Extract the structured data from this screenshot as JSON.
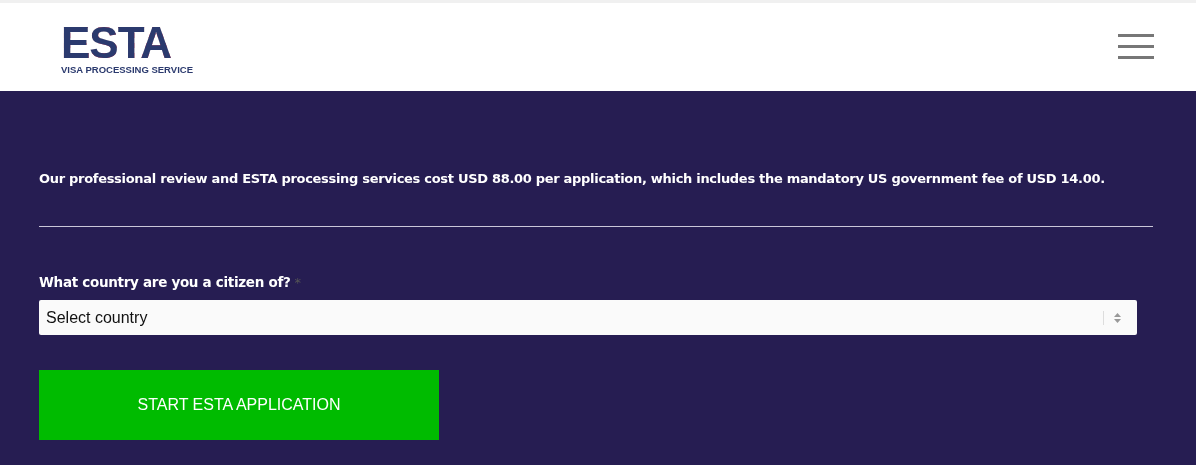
{
  "header": {
    "logo_title": "ESTA",
    "logo_subtitle": "VISA PROCESSING SERVICE"
  },
  "intro": "Our professional review and ESTA processing services cost USD 88.00 per application, which includes the mandatory US government fee of USD 14.00.",
  "form": {
    "label": "What country are you a citizen of?",
    "required_mark": "*",
    "select": {
      "placeholder": "Select country"
    },
    "submit": "START ESTA APPLICATION"
  }
}
